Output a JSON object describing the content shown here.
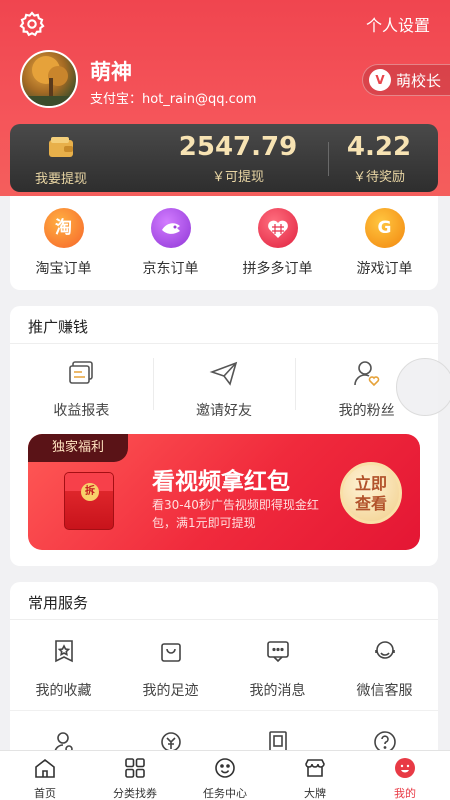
{
  "header": {
    "settings_link": "个人设置",
    "user": {
      "name": "萌神",
      "alipay": "支付宝：hot_rain@qq.com"
    },
    "principal_badge": {
      "icon_text": "V",
      "label": "萌校长"
    }
  },
  "wallet": {
    "withdraw_label": "我要提现",
    "balance": {
      "value": "2547.79",
      "label": "￥可提现"
    },
    "reward": {
      "value": "4.22",
      "label": "￥待奖励"
    }
  },
  "orders": [
    {
      "icon_text": "淘",
      "label": "淘宝订单",
      "color": "#f6852c"
    },
    {
      "icon_text": "",
      "label": "京东订单",
      "color": "#a54de0"
    },
    {
      "icon_text": "",
      "label": "拼多多订单",
      "color": "#ee3b58"
    },
    {
      "icon_text": "G",
      "label": "游戏订单",
      "color": "#f89c1a"
    }
  ],
  "promo": {
    "title": "推广赚钱",
    "items": [
      {
        "label": "收益报表",
        "icon": "report-icon"
      },
      {
        "label": "邀请好友",
        "icon": "paper-plane-icon"
      },
      {
        "label": "我的粉丝",
        "icon": "fans-icon"
      }
    ],
    "banner": {
      "tag": "独家福利",
      "envelope_text": "拆",
      "title": "看视频拿红包",
      "desc": "看30-40秒广告视频即得现金红包，满1元即可提现",
      "button_line1": "立即",
      "button_line2": "查看"
    }
  },
  "services": {
    "title": "常用服务",
    "items": [
      {
        "label": "我的收藏",
        "icon": "star-box-icon"
      },
      {
        "label": "我的足迹",
        "icon": "bag-icon"
      },
      {
        "label": "我的消息",
        "icon": "message-icon"
      },
      {
        "label": "微信客服",
        "icon": "support-icon"
      }
    ]
  },
  "tabbar": [
    {
      "label": "首页",
      "icon": "home-icon"
    },
    {
      "label": "分类找券",
      "icon": "grid-icon"
    },
    {
      "label": "任务中心",
      "icon": "face-icon"
    },
    {
      "label": "大牌",
      "icon": "store-icon"
    },
    {
      "label": "我的",
      "icon": "me-icon",
      "active": true
    }
  ],
  "colors": {
    "accent": "#f0454f",
    "gold": "#f7e3b3"
  }
}
